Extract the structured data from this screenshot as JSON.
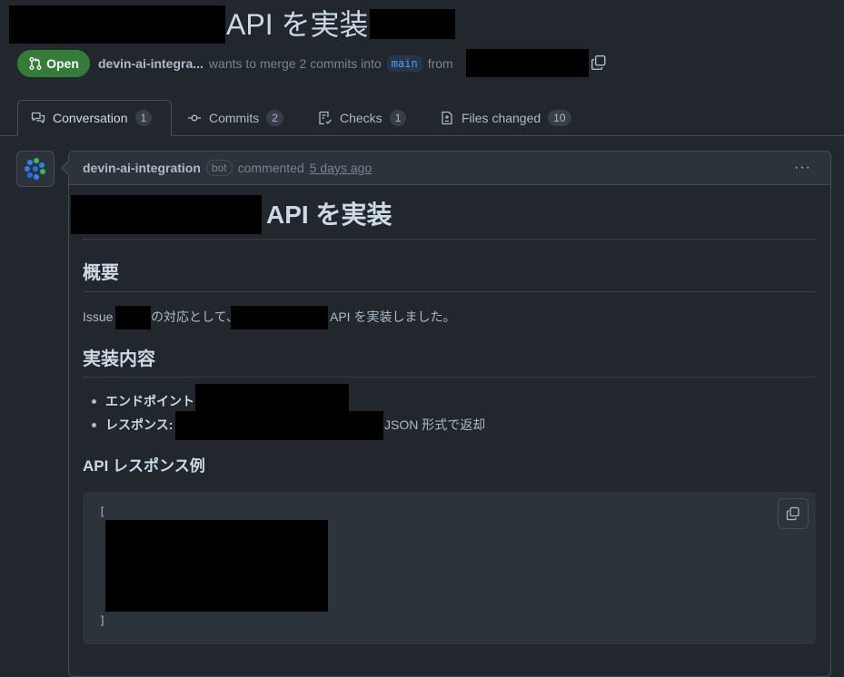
{
  "pr": {
    "title": "API を実装",
    "state": "Open",
    "author": "devin-ai-integra...",
    "wants_to_merge": "wants to merge 2 commits into",
    "base_branch": "main",
    "from": "from"
  },
  "tabs": [
    {
      "label": "Conversation",
      "count": "1",
      "icon": "comment-discussion-icon"
    },
    {
      "label": "Commits",
      "count": "2",
      "icon": "git-commit-icon"
    },
    {
      "label": "Checks",
      "count": "1",
      "icon": "checklist-icon"
    },
    {
      "label": "Files changed",
      "count": "10",
      "icon": "file-diff-icon"
    }
  ],
  "comment": {
    "author": "devin-ai-integration",
    "badge": "bot",
    "action": "commented",
    "time": "5 days ago",
    "menu": "···"
  },
  "body": {
    "h1": "API を実装",
    "section1_title": "概要",
    "issue_word": "Issue",
    "issue_mid": "の対応として、",
    "issue_tail": "API を実装しました。",
    "section2_title": "実装内容",
    "bullet1_label": "エンドポイント:",
    "bullet2_label": "レスポンス:",
    "bullet2_tail": "JSON 形式で返却",
    "section3_title": "API レスポンス例",
    "code_open": "[",
    "code_close": "]"
  },
  "colors": {
    "background": "#22272e",
    "open_badge": "#347d39",
    "branch_link": "#539bf5"
  }
}
